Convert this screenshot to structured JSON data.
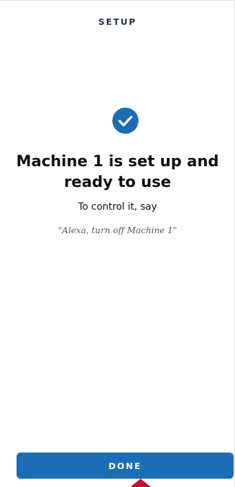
{
  "header": {
    "title": "SETUP"
  },
  "status": {
    "icon": "check-circle-icon",
    "headline": "Machine 1 is set up and ready to use",
    "instruction": "To control it, say",
    "voice_phrase": "\"Alexa, turn off Machine 1\""
  },
  "footer": {
    "done_label": "DONE"
  },
  "annotation": {
    "icon": "red-arrow-up-icon"
  },
  "colors": {
    "accent": "#1b6eb5",
    "pointer": "#c8102e"
  }
}
